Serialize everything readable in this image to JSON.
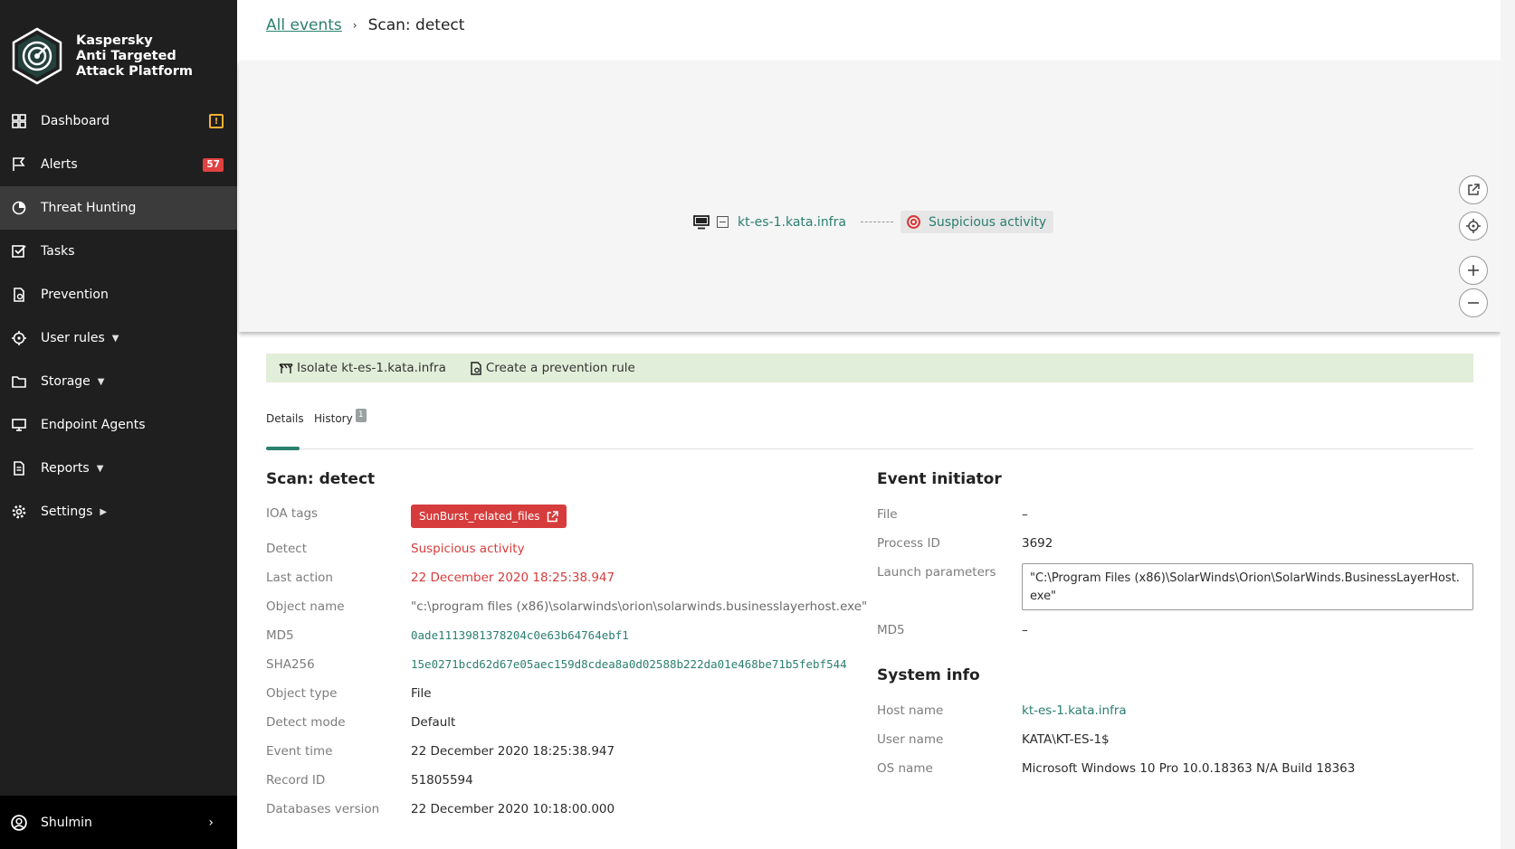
{
  "app": {
    "logo_lines": [
      "Kaspersky",
      "Anti Targeted",
      "Attack Platform"
    ]
  },
  "sidebar": {
    "items": [
      {
        "label": "Dashboard",
        "icon": "dashboard-icon"
      },
      {
        "label": "Alerts",
        "icon": "flag-icon",
        "badge": "57"
      },
      {
        "label": "Threat Hunting",
        "icon": "threat-hunting-icon"
      },
      {
        "label": "Tasks",
        "icon": "checkbox-icon"
      },
      {
        "label": "Prevention",
        "icon": "prevention-icon"
      },
      {
        "label": "User rules",
        "icon": "target-icon"
      },
      {
        "label": "Storage",
        "icon": "folder-icon"
      },
      {
        "label": "Endpoint Agents",
        "icon": "monitor-icon"
      },
      {
        "label": "Reports",
        "icon": "report-icon"
      },
      {
        "label": "Settings",
        "icon": "gear-icon"
      }
    ],
    "warning_badge": "!",
    "user": "Shulmin"
  },
  "breadcrumb": {
    "parent": "All events",
    "current": "Scan: detect"
  },
  "graph": {
    "host": "kt-es-1.kata.infra",
    "event": "Suspicious activity"
  },
  "actions": {
    "isolate": "Isolate kt-es-1.kata.infra",
    "create_rule": "Create a prevention rule"
  },
  "tabs": {
    "details": "Details",
    "history": "History",
    "history_count": "1"
  },
  "details": {
    "title": "Scan: detect",
    "rows": [
      {
        "label": "IOA tags",
        "value": "SunBurst_related_files"
      },
      {
        "label": "Detect",
        "value": "Suspicious activity"
      },
      {
        "label": "Last action",
        "value": "22 December 2020 18:25:38.947"
      },
      {
        "label": "Object name",
        "value": "\"c:\\program files (x86)\\solarwinds\\orion\\solarwinds.businesslayerhost.exe\""
      },
      {
        "label": "MD5",
        "value": "0ade1113981378204c0e63b64764ebf1"
      },
      {
        "label": "SHA256",
        "value": "15e0271bcd62d67e05aec159d8cdea8a0d02588b222da01e468be71b5febf544"
      },
      {
        "label": "Object type",
        "value": "File"
      },
      {
        "label": "Detect mode",
        "value": "Default"
      },
      {
        "label": "Event time",
        "value": "22 December 2020 18:25:38.947"
      },
      {
        "label": "Record ID",
        "value": "51805594"
      },
      {
        "label": "Databases version",
        "value": "22 December 2020 10:18:00.000"
      }
    ]
  },
  "initiator": {
    "title": "Event initiator",
    "file_label": "File",
    "file_value": "–",
    "pid_label": "Process ID",
    "pid_value": "3692",
    "launch_label": "Launch parameters",
    "launch_value": "\"C:\\Program Files (x86)\\SolarWinds\\Orion\\SolarWinds.BusinessLayerHost.exe\"",
    "md5_label": "MD5",
    "md5_value": "–"
  },
  "system": {
    "title": "System info",
    "host_label": "Host name",
    "host_value": "kt-es-1.kata.infra",
    "user_label": "User name",
    "user_value": "KATA\\KT-ES-1$",
    "os_label": "OS name",
    "os_value": "Microsoft Windows 10 Pro 10.0.18363 N/A Build 18363"
  },
  "colors": {
    "accent": "#2a7f6f",
    "danger": "#d63c3c",
    "sidebar": "#1f1f1f",
    "action_bar": "#e1eed9"
  }
}
